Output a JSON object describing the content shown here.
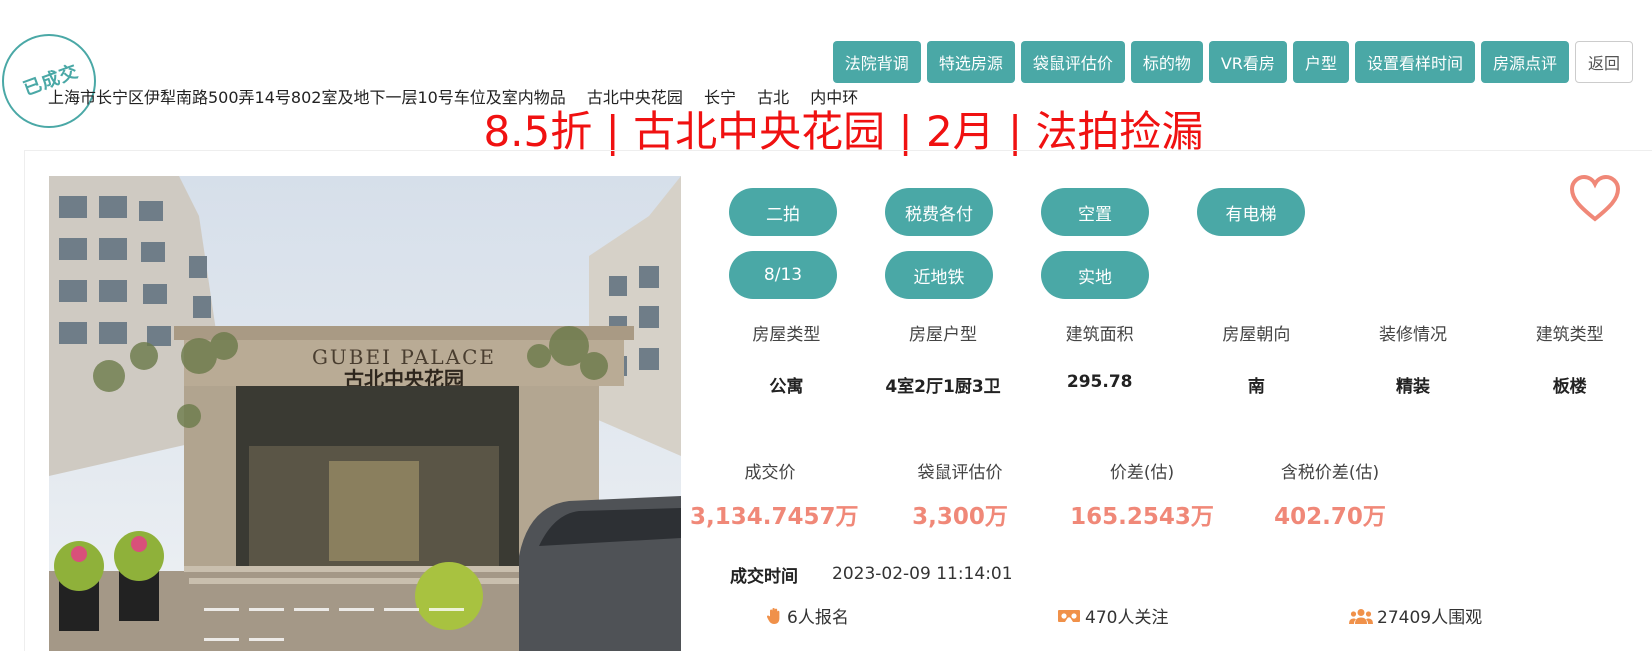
{
  "stamp": "已成交",
  "nav": [
    "法院背调",
    "特选房源",
    "袋鼠评估价",
    "标的物",
    "VR看房",
    "户型",
    "设置看样时间",
    "房源点评"
  ],
  "nav_back": "返回",
  "address_parts": [
    "上海市长宁区伊犁南路500弄14号802室及地下一层10号车位及室内物品",
    "古北中央花园",
    "长宁",
    "古北",
    "内中环"
  ],
  "headline": "8.5折 | 古北中央花园 | 2月 | 法拍捡漏",
  "photo": {
    "sign_en": "GUBEI   PALACE",
    "sign_cn": "古北中央花园"
  },
  "tags": [
    "二拍",
    "税费各付",
    "空置",
    "有电梯",
    "8/13",
    "近地铁",
    "实地"
  ],
  "attributes": {
    "labels": [
      "房屋类型",
      "房屋户型",
      "建筑面积",
      "房屋朝向",
      "装修情况",
      "建筑类型"
    ],
    "values": [
      "公寓",
      "4室2厅1厨3卫",
      "295.78",
      "南",
      "精装",
      "板楼"
    ]
  },
  "prices": [
    {
      "label": "成交价",
      "value": "3,134.7457万"
    },
    {
      "label": "袋鼠评估价",
      "value": "3,300万"
    },
    {
      "label": "价差(估)",
      "value": "165.2543万"
    },
    {
      "label": "含税价差(估)",
      "value": "402.70万"
    }
  ],
  "deal": {
    "label": "成交时间",
    "time": "2023-02-09 11:14:01"
  },
  "stats": {
    "signup": "6人报名",
    "follow": "470人关注",
    "watch": "27409人围观"
  },
  "colors": {
    "accent": "#4aa8a6",
    "headline": "#f01111",
    "price": "#f08878",
    "heart": "#f08878"
  }
}
